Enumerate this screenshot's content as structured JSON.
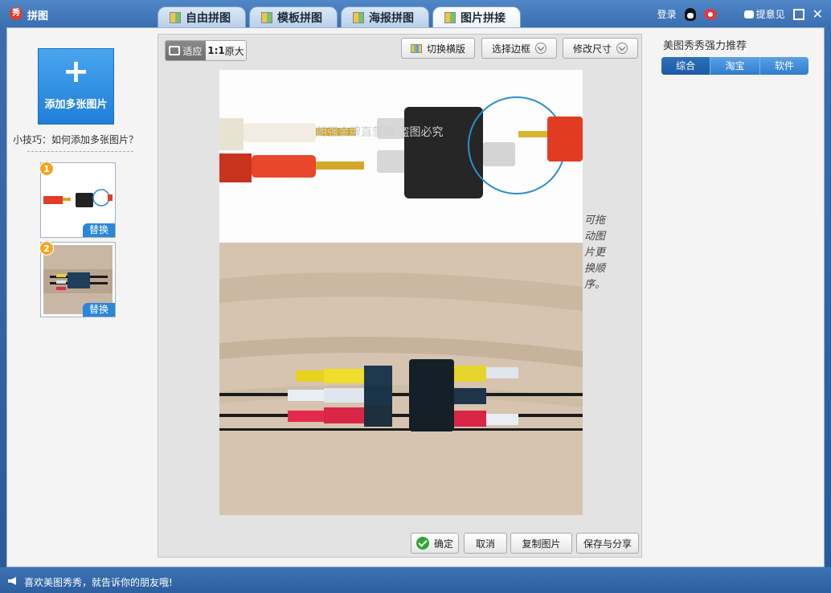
{
  "app": {
    "logo": "秀",
    "title": "拼图"
  },
  "tabs": [
    {
      "label": "自由拼图",
      "active": false
    },
    {
      "label": "模板拼图",
      "active": false
    },
    {
      "label": "海报拼图",
      "active": false
    },
    {
      "label": "图片拼接",
      "active": true
    }
  ],
  "top_right": {
    "login": "登录",
    "feedback": "提意见"
  },
  "left_panel": {
    "add_label": "添加多张图片",
    "tip": "小技巧：如何添加多张图片？",
    "thumbs": [
      {
        "number": "1",
        "replace_label": "替换"
      },
      {
        "number": "2",
        "replace_label": "替换"
      }
    ]
  },
  "toolbar": {
    "fit_label": "适应",
    "orig_prefix": "1:1",
    "orig_label": "原大",
    "switch_label": "切换横版",
    "border_label": "选择边框",
    "resize_label": "修改尺寸"
  },
  "canvas": {
    "watermark": "朗强金牌直营店 盗图必究",
    "hint": "可拖动图片更换顺序。"
  },
  "actions": {
    "confirm": "确定",
    "cancel": "取消",
    "copy": "复制图片",
    "save_share": "保存与分享"
  },
  "right_panel": {
    "title": "美图秀秀强力推荐",
    "tabs": [
      {
        "label": "综合",
        "active": true
      },
      {
        "label": "淘宝",
        "active": false
      },
      {
        "label": "软件",
        "active": false
      }
    ]
  },
  "status": {
    "text": "喜欢美图秀秀，就告诉你的朋友哦!"
  }
}
